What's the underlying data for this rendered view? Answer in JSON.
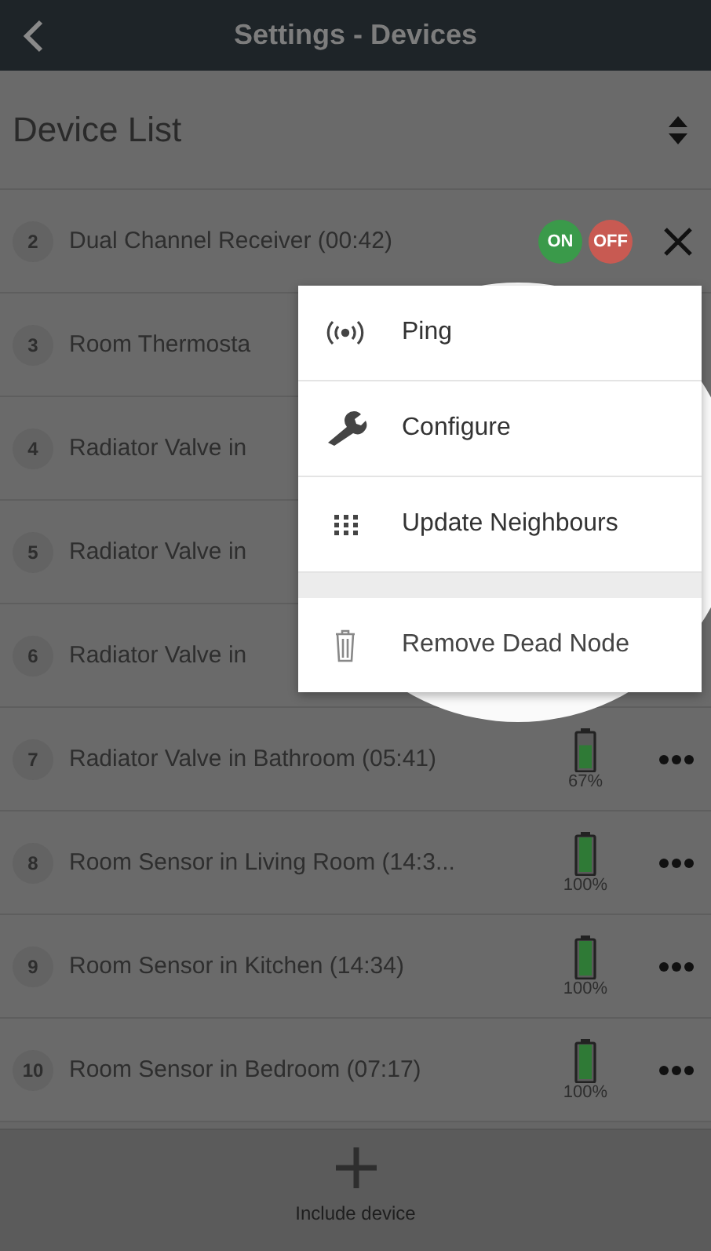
{
  "header": {
    "title": "Settings - Devices"
  },
  "list_title": "Device List",
  "devices": [
    {
      "number": "2",
      "name": "Dual Channel Receiver (00:42)",
      "kind": "switch",
      "on_label": "ON",
      "off_label": "OFF"
    },
    {
      "number": "3",
      "name": "Room Thermosta",
      "kind": "plain"
    },
    {
      "number": "4",
      "name": "Radiator Valve in",
      "kind": "plain"
    },
    {
      "number": "5",
      "name": "Radiator Valve in",
      "kind": "plain"
    },
    {
      "number": "6",
      "name": "Radiator Valve in",
      "kind": "plain"
    },
    {
      "number": "7",
      "name": "Radiator Valve in Bathroom (05:41)",
      "kind": "battery",
      "level": 0.67,
      "reading": "67%"
    },
    {
      "number": "8",
      "name": "Room Sensor in Living Room (14:3...",
      "kind": "battery",
      "level": 1,
      "reading": "100%"
    },
    {
      "number": "9",
      "name": "Room Sensor in Kitchen (14:34)",
      "kind": "battery",
      "level": 1,
      "reading": "100%"
    },
    {
      "number": "10",
      "name": "Room Sensor in Bedroom (07:17)",
      "kind": "battery",
      "level": 1,
      "reading": "100%"
    }
  ],
  "menu": {
    "items": [
      {
        "kind": "ping",
        "label": "Ping"
      },
      {
        "kind": "configure",
        "label": "Configure"
      },
      {
        "kind": "neighbours",
        "label": "Update Neighbours"
      },
      {
        "kind": "separator"
      },
      {
        "kind": "remove",
        "label": "Remove Dead Node"
      }
    ]
  },
  "footer": {
    "label": "Include device"
  }
}
